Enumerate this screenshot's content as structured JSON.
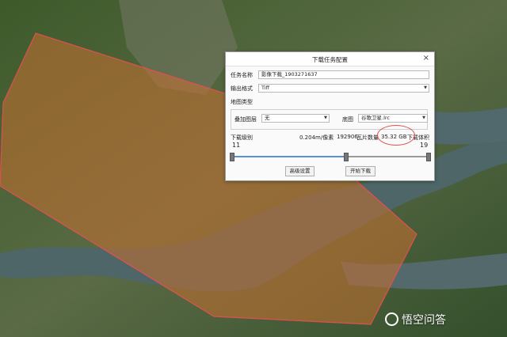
{
  "dialog": {
    "title": "下载任务配置",
    "close_label": "×",
    "task_name_label": "任务名称",
    "task_name_value": "影像下载_1903271637",
    "output_format_label": "输出格式",
    "output_format_value": "Tiff",
    "map_type_label": "地图类型",
    "overlay_label": "叠加图层",
    "overlay_value": "无",
    "base_label": "底图",
    "base_value": "谷歌卫星.lrc",
    "level_label": "下载级别",
    "resolution": "0.204m/像素",
    "tile_count_value": "192906",
    "tile_count_label": "瓦片数量",
    "volume_value": "35.32 GB",
    "volume_label": "下载体积",
    "level_min": "11",
    "level_max": "19",
    "level_range_fraction": [
      0.0,
      0.58,
      1.0
    ],
    "advanced_button": "高级设置",
    "start_button": "开始下载"
  },
  "watermark": {
    "text": "悟空问答"
  },
  "colors": {
    "selection_fill": "#c8702f",
    "selection_border": "#e05050",
    "highlight_circle": "#e05050",
    "slider_fill": "#5b8fd6"
  }
}
